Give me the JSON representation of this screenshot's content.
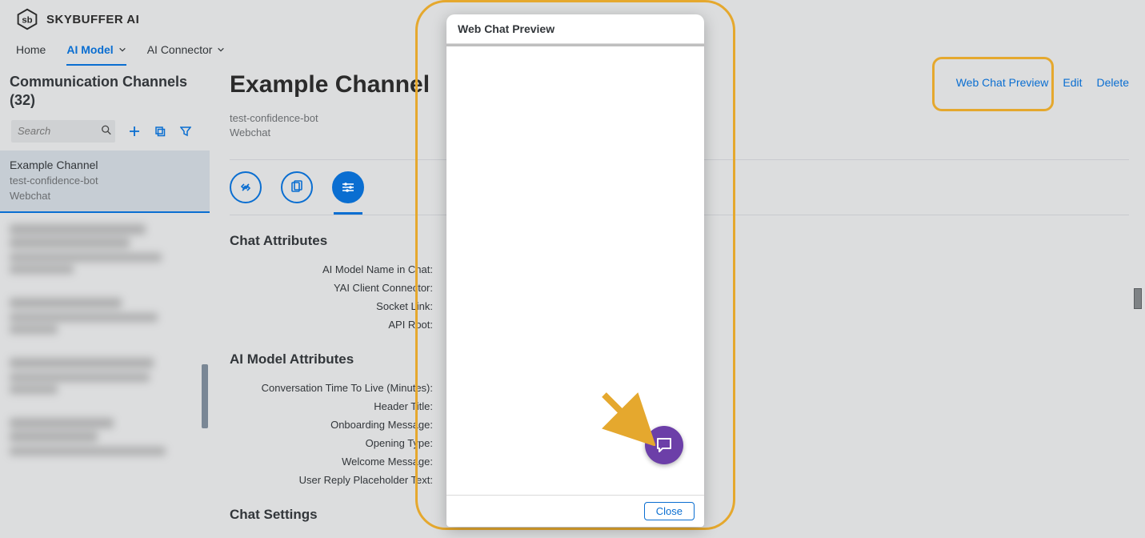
{
  "brand": {
    "name": "SKYBUFFER AI",
    "logo_letters": "sb"
  },
  "nav": {
    "home": "Home",
    "ai_model": "AI Model",
    "ai_connector": "AI Connector"
  },
  "sidebar": {
    "title": "Communication Channels (32)",
    "search_placeholder": "Search",
    "selected": {
      "title": "Example Channel",
      "sub1": "test-confidence-bot",
      "sub2": "Webchat"
    }
  },
  "page": {
    "title": "Example Channel",
    "subtitle_1": "test-confidence-bot",
    "subtitle_2": "Webchat",
    "actions": {
      "preview": "Web Chat Preview",
      "edit": "Edit",
      "delete": "Delete"
    }
  },
  "sections": {
    "chat_attributes": {
      "title": "Chat Attributes",
      "rows": {
        "model_name": "AI Model Name in Chat:",
        "yai_connector": "YAI Client Connector:",
        "socket": "Socket Link:",
        "api_root": "API Root:"
      }
    },
    "ai_model_attributes": {
      "title": "AI Model Attributes",
      "rows": {
        "ttl": "Conversation Time To Live (Minutes):",
        "header_title": "Header Title:",
        "onboarding": "Onboarding Message:",
        "opening": "Opening Type:",
        "welcome": "Welcome Message:",
        "reply_placeholder": "User Reply Placeholder Text:"
      }
    },
    "chat_settings": {
      "title": "Chat Settings"
    }
  },
  "modal": {
    "title": "Web Chat Preview",
    "close": "Close"
  }
}
